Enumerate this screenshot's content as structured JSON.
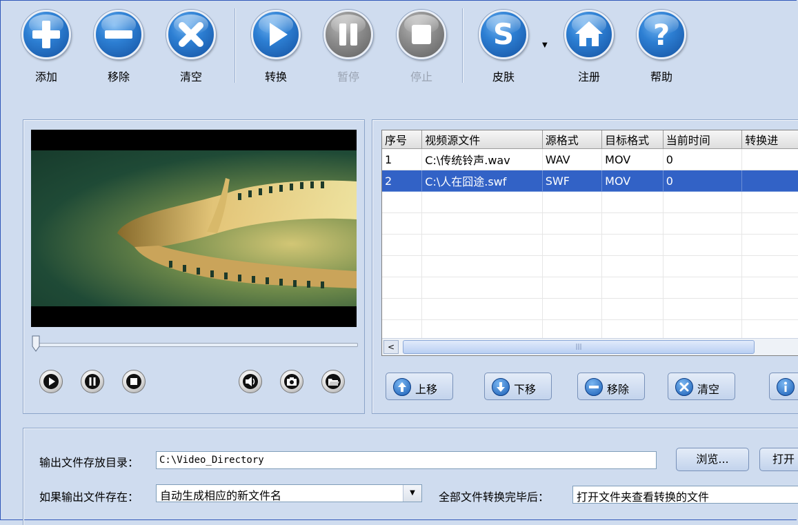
{
  "toolbar": {
    "add": "添加",
    "remove": "移除",
    "clear": "清空",
    "convert": "转换",
    "pause": "暂停",
    "stop": "停止",
    "skin": "皮肤",
    "register": "注册",
    "help": "帮助"
  },
  "colors": {
    "accent_blue": "#2d7fd3",
    "disabled_gray": "#8b8b8b",
    "selection": "#3262c6",
    "background": "#cfdcef"
  },
  "player": {
    "controls": [
      "play-icon",
      "pause-icon",
      "stop-icon",
      "volume-icon",
      "snapshot-icon",
      "open-folder-icon"
    ],
    "progress": 0.0
  },
  "file_list": {
    "columns": [
      "序号",
      "视频源文件",
      "源格式",
      "目标格式",
      "当前时间",
      "转换进"
    ],
    "rows": [
      [
        "1",
        "C:\\传统铃声.wav",
        "WAV",
        "MOV",
        "0",
        ""
      ],
      [
        "2",
        "C:\\人在囧途.swf",
        "SWF",
        "MOV",
        "0",
        ""
      ]
    ],
    "selected_row": 2
  },
  "list_actions": {
    "move_up": "上移",
    "move_down": "下移",
    "remove": "移除",
    "clear": "清空"
  },
  "output": {
    "dir_label": "输出文件存放目录：",
    "dir_value": "C:\\Video_Directory",
    "browse": "浏览...",
    "open": "打开",
    "exists_label": "如果输出文件存在：",
    "exists_value": "自动生成相应的新文件名",
    "after_label": "全部文件转换完毕后：",
    "after_value": "打开文件夹查看转换的文件"
  }
}
